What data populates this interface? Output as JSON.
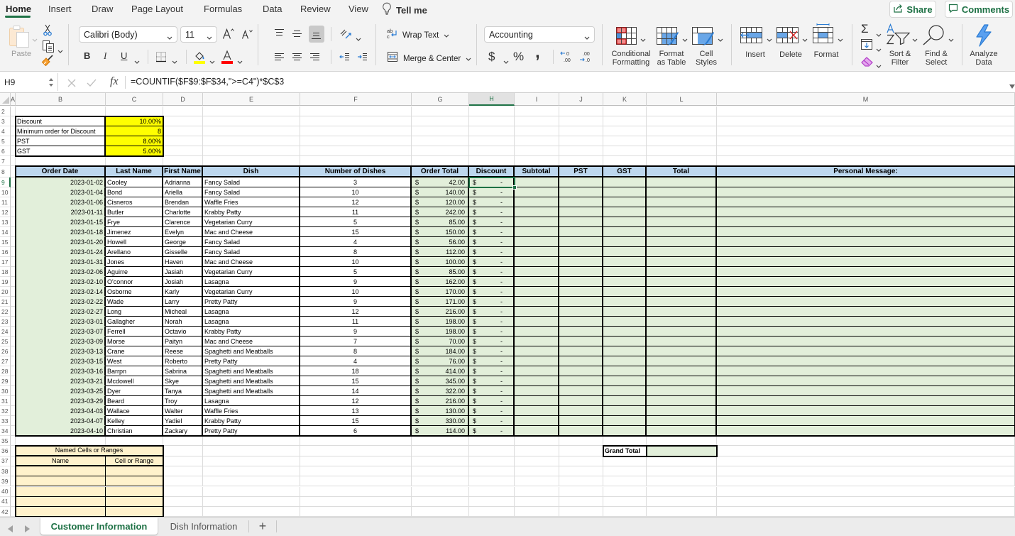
{
  "ribbon": {
    "tabs": [
      {
        "label": "Home",
        "active": true
      },
      {
        "label": "Insert"
      },
      {
        "label": "Draw"
      },
      {
        "label": "Page Layout"
      },
      {
        "label": "Formulas"
      },
      {
        "label": "Data"
      },
      {
        "label": "Review"
      },
      {
        "label": "View"
      }
    ],
    "tell_me": {
      "label": "Tell me",
      "icon": "lightbulb-icon"
    },
    "share": {
      "label": "Share",
      "icon": "share-icon"
    },
    "comments": {
      "label": "Comments",
      "icon": "comment-icon"
    },
    "clipboard": {
      "paste_label": "Paste",
      "icons": [
        "clipboard-icon",
        "scissors-icon",
        "copy-icon",
        "format-painter-icon"
      ]
    },
    "font": {
      "name": "Calibri (Body)",
      "size": "11",
      "bold": "B",
      "italic": "I",
      "underline": "U",
      "highlight_color": "#FFFF00",
      "font_color": "#FF0000",
      "icons": [
        "increase-font-size-icon",
        "decrease-font-size-icon",
        "borders-icon",
        "fill-color-icon",
        "font-color-icon"
      ]
    },
    "alignment": {
      "wrap_text": "Wrap Text",
      "merge_center": "Merge & Center",
      "selected_vertical_align": "bottom",
      "icons": [
        "align-top-icon",
        "align-middle-icon",
        "align-bottom-icon",
        "orientation-icon",
        "align-left-icon",
        "align-center-icon",
        "align-right-icon",
        "decrease-indent-icon",
        "increase-indent-icon",
        "wrap-text-icon",
        "merge-center-icon"
      ]
    },
    "number": {
      "format": "Accounting",
      "currency": "$",
      "percent": "%",
      "comma": ",",
      "icons": [
        "increase-decimal-icon",
        "decrease-decimal-icon"
      ]
    },
    "styles": {
      "conditional_formatting": [
        "Conditional",
        "Formatting"
      ],
      "format_as_table": [
        "Format",
        "as Table"
      ],
      "cell_styles": [
        "Cell",
        "Styles"
      ]
    },
    "cells": {
      "insert": "Insert",
      "delete": "Delete",
      "format": "Format"
    },
    "editing": {
      "autosum": "Σ",
      "sort_filter": [
        "Sort &",
        "Filter"
      ],
      "find_select": [
        "Find &",
        "Select"
      ],
      "icons": [
        "fill-down-icon",
        "clear-eraser-icon",
        "sort-filter-icon",
        "magnifier-icon"
      ]
    },
    "analyze_data": [
      "Analyze",
      "Data"
    ]
  },
  "formula_bar": {
    "name_box": "H9",
    "fx_label": "fx",
    "formula": "=COUNTIF($F$9:$F$34,\">=C4\")*$C$3"
  },
  "sheet": {
    "column_headers": [
      "A",
      "B",
      "C",
      "D",
      "E",
      "F",
      "G",
      "H",
      "I",
      "J",
      "K",
      "L",
      "M"
    ],
    "row_numbers": [
      2,
      3,
      4,
      5,
      6,
      7,
      8,
      9,
      10,
      11,
      12,
      13,
      14,
      15,
      16,
      17,
      18,
      19,
      20,
      21,
      22,
      23,
      24,
      25,
      26,
      27,
      28,
      29,
      30,
      31,
      32,
      33,
      34,
      35,
      36,
      37,
      38,
      39,
      40,
      41,
      42
    ],
    "selected_cell": {
      "column": "H",
      "row": 9
    }
  },
  "settings": {
    "rows": [
      {
        "label": "Discount",
        "value": "10.00%"
      },
      {
        "label": "Minimum order for Discount",
        "value": "8"
      },
      {
        "label": "PST",
        "value": "8.00%"
      },
      {
        "label": "GST",
        "value": "5.00%"
      }
    ]
  },
  "orders": {
    "headers": [
      "Order Date",
      "Last Name",
      "First Name",
      "Dish",
      "Number of Dishes",
      "Order Total",
      "Discount",
      "Subtotal",
      "PST",
      "GST",
      "Total",
      "Personal Message:"
    ],
    "currency_symbol": "$",
    "rows": [
      {
        "order_date": "2023-01-02",
        "last_name": "Cooley",
        "first_name": "Adrianna",
        "dish": "Fancy Salad",
        "dishes": "3",
        "order_total": "42.00",
        "discount": "-"
      },
      {
        "order_date": "2023-01-04",
        "last_name": "Bond",
        "first_name": "Ariella",
        "dish": "Fancy Salad",
        "dishes": "10",
        "order_total": "140.00",
        "discount": "-"
      },
      {
        "order_date": "2023-01-06",
        "last_name": "Cisneros",
        "first_name": "Brendan",
        "dish": "Waffle Fries",
        "dishes": "12",
        "order_total": "120.00",
        "discount": "-"
      },
      {
        "order_date": "2023-01-11",
        "last_name": "Butler",
        "first_name": "Charlotte",
        "dish": "Krabby Patty",
        "dishes": "11",
        "order_total": "242.00",
        "discount": "-"
      },
      {
        "order_date": "2023-01-15",
        "last_name": "Frye",
        "first_name": "Clarence",
        "dish": "Vegetarian Curry",
        "dishes": "5",
        "order_total": "85.00",
        "discount": "-"
      },
      {
        "order_date": "2023-01-18",
        "last_name": "Jimenez",
        "first_name": "Evelyn",
        "dish": "Mac and Cheese",
        "dishes": "15",
        "order_total": "150.00",
        "discount": "-"
      },
      {
        "order_date": "2023-01-20",
        "last_name": "Howell",
        "first_name": "George",
        "dish": "Fancy Salad",
        "dishes": "4",
        "order_total": "56.00",
        "discount": "-"
      },
      {
        "order_date": "2023-01-24",
        "last_name": "Arellano",
        "first_name": "Gisselle",
        "dish": "Fancy Salad",
        "dishes": "8",
        "order_total": "112.00",
        "discount": "-"
      },
      {
        "order_date": "2023-01-31",
        "last_name": "Jones",
        "first_name": "Haven",
        "dish": "Mac and Cheese",
        "dishes": "10",
        "order_total": "100.00",
        "discount": "-"
      },
      {
        "order_date": "2023-02-06",
        "last_name": "Aguirre",
        "first_name": "Jasiah",
        "dish": "Vegetarian Curry",
        "dishes": "5",
        "order_total": "85.00",
        "discount": "-"
      },
      {
        "order_date": "2023-02-10",
        "last_name": "O'connor",
        "first_name": "Josiah",
        "dish": "Lasagna",
        "dishes": "9",
        "order_total": "162.00",
        "discount": "-"
      },
      {
        "order_date": "2023-02-14",
        "last_name": "Osborne",
        "first_name": "Karly",
        "dish": "Vegetarian Curry",
        "dishes": "10",
        "order_total": "170.00",
        "discount": "-"
      },
      {
        "order_date": "2023-02-22",
        "last_name": "Wade",
        "first_name": "Larry",
        "dish": "Pretty Patty",
        "dishes": "9",
        "order_total": "171.00",
        "discount": "-"
      },
      {
        "order_date": "2023-02-27",
        "last_name": "Long",
        "first_name": "Micheal",
        "dish": "Lasagna",
        "dishes": "12",
        "order_total": "216.00",
        "discount": "-"
      },
      {
        "order_date": "2023-03-01",
        "last_name": "Gallagher",
        "first_name": "Norah",
        "dish": "Lasagna",
        "dishes": "11",
        "order_total": "198.00",
        "discount": "-"
      },
      {
        "order_date": "2023-03-07",
        "last_name": "Ferrell",
        "first_name": "Octavio",
        "dish": "Krabby Patty",
        "dishes": "9",
        "order_total": "198.00",
        "discount": "-"
      },
      {
        "order_date": "2023-03-09",
        "last_name": "Morse",
        "first_name": "Paityn",
        "dish": "Mac and Cheese",
        "dishes": "7",
        "order_total": "70.00",
        "discount": "-"
      },
      {
        "order_date": "2023-03-13",
        "last_name": "Crane",
        "first_name": "Reese",
        "dish": "Spaghetti and Meatballs",
        "dishes": "8",
        "order_total": "184.00",
        "discount": "-"
      },
      {
        "order_date": "2023-03-15",
        "last_name": "West",
        "first_name": "Roberto",
        "dish": "Pretty Patty",
        "dishes": "4",
        "order_total": "76.00",
        "discount": "-"
      },
      {
        "order_date": "2023-03-16",
        "last_name": "Barrpn",
        "first_name": "Sabrina",
        "dish": "Spaghetti and Meatballs",
        "dishes": "18",
        "order_total": "414.00",
        "discount": "-"
      },
      {
        "order_date": "2023-03-21",
        "last_name": "Mcdowell",
        "first_name": "Skye",
        "dish": "Spaghetti and Meatballs",
        "dishes": "15",
        "order_total": "345.00",
        "discount": "-"
      },
      {
        "order_date": "2023-03-25",
        "last_name": "Dyer",
        "first_name": "Tanya",
        "dish": "Spaghetti and Meatballs",
        "dishes": "14",
        "order_total": "322.00",
        "discount": "-"
      },
      {
        "order_date": "2023-03-29",
        "last_name": "Beard",
        "first_name": "Troy",
        "dish": "Lasagna",
        "dishes": "12",
        "order_total": "216.00",
        "discount": "-"
      },
      {
        "order_date": "2023-04-03",
        "last_name": "Wallace",
        "first_name": "Walter",
        "dish": "Waffle Fries",
        "dishes": "13",
        "order_total": "130.00",
        "discount": "-"
      },
      {
        "order_date": "2023-04-07",
        "last_name": "Kelley",
        "first_name": "Yadiel",
        "dish": "Krabby Patty",
        "dishes": "15",
        "order_total": "330.00",
        "discount": "-"
      },
      {
        "order_date": "2023-04-10",
        "last_name": "Christian",
        "first_name": "Zackary",
        "dish": "Pretty Patty",
        "dishes": "6",
        "order_total": "114.00",
        "discount": "-"
      }
    ]
  },
  "named_ranges": {
    "title": "Named Cells or Ranges",
    "headers": [
      "Name",
      "Cell or Range"
    ],
    "rows": [
      [
        "",
        ""
      ],
      [
        "",
        ""
      ],
      [
        "",
        ""
      ],
      [
        "",
        ""
      ],
      [
        "",
        ""
      ]
    ]
  },
  "grand_total": {
    "label": "Grand Total",
    "value": ""
  },
  "sheet_tabs": {
    "tabs": [
      {
        "label": "Customer Information",
        "active": true
      },
      {
        "label": "Dish Information"
      }
    ],
    "add_label": "+"
  },
  "colors": {
    "accent_green": "#1E7145",
    "header_blue": "#BDD7EE",
    "calc_green": "#E2EFDA",
    "input_yellow": "#FFFF00",
    "named_tan": "#FFF2CC"
  }
}
